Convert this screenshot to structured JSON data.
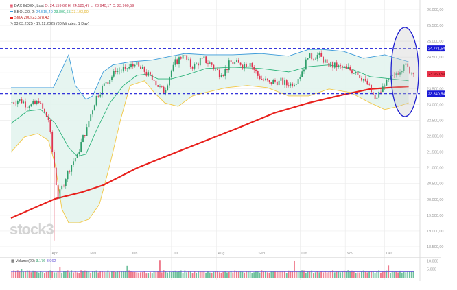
{
  "legend": {
    "instrument": "DAX INDEX, Last",
    "ohlc": "O: 24.159,62  H: 24.185,47  L: 23.940,17  C: 23.960,59",
    "bb_label": "BBOL 20, 2:",
    "bb_upper": "24.515,40",
    "bb_mid": "23.809,65",
    "bb_lower": "23.103,90",
    "sma_label": "SMA(200) 23.578,43",
    "period": "03.03.2025 - 17.12.2025 (30 Minutes, 1 Day)"
  },
  "volume_legend": {
    "label": "Volume(20)",
    "v1": "3.176",
    "v2": "3.962"
  },
  "watermark": "stock3",
  "colors": {
    "up": "#2e9e6a",
    "down": "#e0334f",
    "bb_upper": "#3a9ad9",
    "bb_mid": "#2db37a",
    "bb_lower": "#f2c744",
    "bb_fill": "#e3f4ee",
    "sma": "#e8201c",
    "level": "#1a1ad6",
    "last": "#e8334a"
  },
  "chart_data": {
    "type": "candlestick",
    "title": "DAX INDEX",
    "x_unit": "week index from 03.03.2025",
    "x_ticks": [
      {
        "label": "Apr",
        "week": 4.1
      },
      {
        "label": "Mai",
        "week": 8.1
      },
      {
        "label": "Jun",
        "week": 12.4
      },
      {
        "label": "Jul",
        "week": 16.7
      },
      {
        "label": "Aug",
        "week": 21.4
      },
      {
        "label": "Sep",
        "week": 25.6
      },
      {
        "label": "Okt",
        "week": 30.1
      },
      {
        "label": "Nov",
        "week": 34.8
      },
      {
        "label": "Dez",
        "week": 38.9
      }
    ],
    "y_ticks": [
      "26.000,00",
      "25.500,00",
      "25.000,00",
      "24.500,00",
      "24.000,00",
      "23.500,00",
      "23.000,00",
      "22.500,00",
      "22.000,00",
      "21.500,00",
      "21.000,00",
      "20.500,00",
      "20.000,00",
      "19.500,00",
      "19.000,00",
      "18.500,00"
    ],
    "y_tick_values": [
      26000,
      25500,
      25000,
      24500,
      24000,
      23500,
      23000,
      22500,
      22000,
      21500,
      21000,
      20500,
      20000,
      19500,
      19000,
      18500
    ],
    "ylim": [
      18500,
      26000
    ],
    "weekly_close": [
      23050,
      23160,
      22940,
      23050,
      22510,
      20020,
      20890,
      21430,
      22290,
      23270,
      23700,
      24030,
      24140,
      24250,
      24030,
      23750,
      23380,
      24250,
      24570,
      24140,
      24460,
      24250,
      23920,
      24350,
      24250,
      24310,
      23810,
      23700,
      23750,
      23600,
      23810,
      24460,
      24570,
      24310,
      24180,
      24140,
      24030,
      23750,
      23160,
      23600,
      23920,
      24250,
      23960
    ],
    "notable_low": {
      "week": 5,
      "price": 18700
    },
    "bollinger_upper": [
      [
        0,
        23530
      ],
      [
        1.7,
        23530
      ],
      [
        4.4,
        23530
      ],
      [
        6,
        24570
      ],
      [
        6.7,
        23600
      ],
      [
        7.8,
        23160
      ],
      [
        8.5,
        23270
      ],
      [
        9.6,
        24030
      ],
      [
        10.6,
        24250
      ],
      [
        12.4,
        24350
      ],
      [
        14.6,
        24400
      ],
      [
        16.7,
        24530
      ],
      [
        18.1,
        24610
      ],
      [
        20.3,
        24570
      ],
      [
        23.1,
        24570
      ],
      [
        26,
        24610
      ],
      [
        28.9,
        24530
      ],
      [
        31,
        24740
      ],
      [
        32.4,
        24740
      ],
      [
        34.6,
        24680
      ],
      [
        36.7,
        24460
      ],
      [
        38.9,
        24570
      ],
      [
        41.4,
        24350
      ]
    ],
    "bollinger_mid": [
      [
        0,
        22400
      ],
      [
        1.7,
        22790
      ],
      [
        3.1,
        22840
      ],
      [
        4.6,
        22400
      ],
      [
        6,
        21640
      ],
      [
        6.9,
        21360
      ],
      [
        7.8,
        21430
      ],
      [
        8.9,
        22190
      ],
      [
        10.3,
        23050
      ],
      [
        11.7,
        23600
      ],
      [
        13.1,
        23920
      ],
      [
        14.2,
        23960
      ],
      [
        15.3,
        23810
      ],
      [
        16.7,
        23810
      ],
      [
        18.1,
        23920
      ],
      [
        20.3,
        24140
      ],
      [
        23.1,
        24180
      ],
      [
        26,
        24140
      ],
      [
        28.9,
        24030
      ],
      [
        31,
        24200
      ],
      [
        33.1,
        24250
      ],
      [
        35.3,
        24140
      ],
      [
        37.4,
        23880
      ],
      [
        39.6,
        23810
      ],
      [
        41.4,
        23750
      ]
    ],
    "bollinger_lower": [
      [
        0,
        21490
      ],
      [
        1.4,
        21970
      ],
      [
        2.8,
        22080
      ],
      [
        3.9,
        21860
      ],
      [
        4.6,
        21100
      ],
      [
        5.3,
        19690
      ],
      [
        6,
        19260
      ],
      [
        7.1,
        19260
      ],
      [
        8.1,
        19370
      ],
      [
        9.2,
        19840
      ],
      [
        10.3,
        21100
      ],
      [
        11.4,
        22510
      ],
      [
        12.4,
        23600
      ],
      [
        13.9,
        23750
      ],
      [
        14.9,
        23380
      ],
      [
        16,
        23050
      ],
      [
        17.4,
        22940
      ],
      [
        18.9,
        23270
      ],
      [
        20.3,
        23380
      ],
      [
        22.4,
        23530
      ],
      [
        24.6,
        23600
      ],
      [
        26.7,
        23530
      ],
      [
        28.9,
        23270
      ],
      [
        31,
        23270
      ],
      [
        33.1,
        23490
      ],
      [
        35.3,
        23380
      ],
      [
        37.4,
        23050
      ],
      [
        38.9,
        22840
      ],
      [
        40.3,
        22940
      ],
      [
        41.4,
        23050
      ]
    ],
    "sma200": [
      [
        0,
        19410
      ],
      [
        4.6,
        20020
      ],
      [
        7.4,
        20230
      ],
      [
        9.6,
        20450
      ],
      [
        13.1,
        20990
      ],
      [
        16.7,
        21430
      ],
      [
        20.3,
        21860
      ],
      [
        23.9,
        22290
      ],
      [
        27.4,
        22730
      ],
      [
        31,
        23050
      ],
      [
        34.6,
        23310
      ],
      [
        37.4,
        23490
      ],
      [
        41.4,
        23570
      ]
    ],
    "levels": [
      {
        "label": "24.771,54",
        "value": 24771.54
      },
      {
        "label": "23.340,54",
        "value": 23340.54
      }
    ],
    "last_price": {
      "label": "23.960,59",
      "value": 23960.59
    },
    "volume": {
      "ticks": [
        "10.000",
        "5.000"
      ],
      "tick_values": [
        10000,
        5000
      ],
      "spike_weeks": [
        [
          1,
          5200
        ],
        [
          5,
          6500
        ],
        [
          12,
          7000
        ],
        [
          15.4,
          10500
        ],
        [
          29.4,
          10200
        ],
        [
          39.2,
          7200
        ]
      ]
    }
  }
}
